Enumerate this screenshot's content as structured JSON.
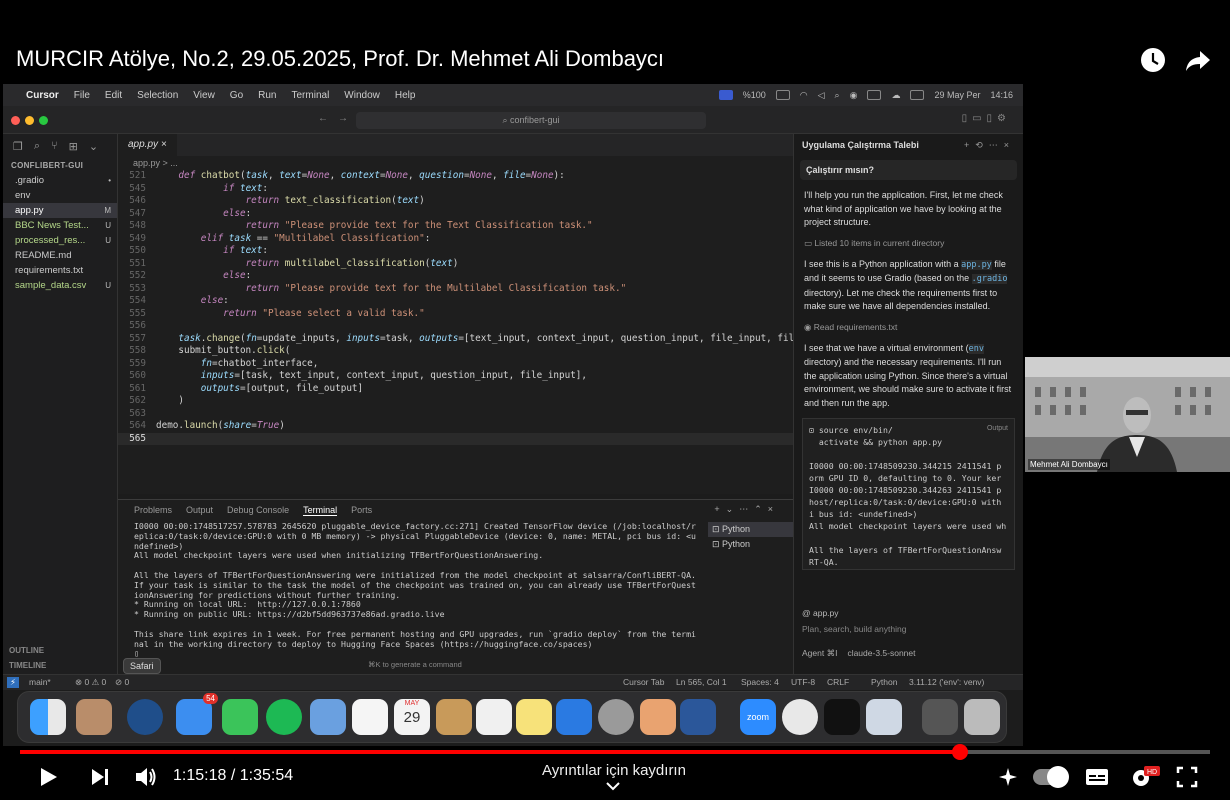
{
  "video": {
    "title": "MURCIR Atölye, No.2, 29.05.2025, Prof. Dr. Mehmet Ali Dombaycı",
    "current_time": "1:15:18",
    "separator": "/",
    "duration": "1:35:54",
    "progress_fraction": 0.79,
    "scroll_hint": "Ayrıntılar için kaydırın"
  },
  "mac_menu": {
    "app": "Cursor",
    "items": [
      "File",
      "Edit",
      "Selection",
      "View",
      "Go",
      "Run",
      "Terminal",
      "Window",
      "Help"
    ],
    "battery": "%100",
    "date": "29 May Per",
    "time": "14:16"
  },
  "window": {
    "search": "confibert-gui"
  },
  "explorer": {
    "project": "CONFLIBERT-GUI",
    "files": [
      {
        "name": ".gradio",
        "status": "•"
      },
      {
        "name": "env",
        "status": ""
      },
      {
        "name": "app.py",
        "status": "M"
      },
      {
        "name": "BBC News Test...",
        "status": "U"
      },
      {
        "name": "processed_res...",
        "status": "U"
      },
      {
        "name": "README.md",
        "status": ""
      },
      {
        "name": "requirements.txt",
        "status": ""
      },
      {
        "name": "sample_data.csv",
        "status": "U"
      }
    ],
    "outline": "OUTLINE",
    "timeline": "TIMELINE"
  },
  "editor": {
    "tab": "app.py",
    "breadcrumb": "app.py > ...",
    "line_numbers": [
      "521",
      "545",
      "546",
      "547",
      "548",
      "549",
      "550",
      "551",
      "552",
      "553",
      "554",
      "555",
      "556",
      "557",
      "558",
      "559",
      "560",
      "561",
      "562",
      "563",
      "564",
      "565"
    ]
  },
  "panel": {
    "tabs": [
      "Problems",
      "Output",
      "Debug Console",
      "Terminal",
      "Ports"
    ],
    "terminal_output": "I0000 00:00:1748517257.578783 2645620 pluggable_device_factory.cc:271] Created TensorFlow device (/job:localhost/replica:0/task:0/device:GPU:0 with 0 MB memory) -> physical PluggableDevice (device: 0, name: METAL, pci bus id: <undefined>)\nAll model checkpoint layers were used when initializing TFBertForQuestionAnswering.\n\nAll the layers of TFBertForQuestionAnswering were initialized from the model checkpoint at salsarra/ConfliBERT-QA.\nIf your task is similar to the task the model of the checkpoint was trained on, you can already use TFBertForQuestionAnswering for predictions without further training.\n* Running on local URL:  http://127.0.0.1:7860\n* Running on public URL: https://d2bf5dd963737e86ad.gradio.live\n\nThis share link expires in 1 week. For free permanent hosting and GPU upgrades, run `gradio deploy` from the terminal in the working directory to deploy to Hugging Face Spaces (https://huggingface.co/spaces)\n▯",
    "terminals": [
      "Python",
      "Python"
    ],
    "hint": "⌘K to generate a command"
  },
  "chat": {
    "header": "Uygulama Çalıştırma Talebi",
    "question": "Çalıştırır mısın?",
    "p1": "I'll help you run the application. First, let me check what kind of application we have by looking at the project structure.",
    "meta1": "Listed 10 items in current directory",
    "p2a": "I see this is a Python application with a ",
    "p2code1": "app.py",
    "p2b": " file and it seems to use Gradio (based on the ",
    "p2code2": ".gradio",
    "p2c": " directory). Let me check the requirements first to make sure we have all dependencies installed.",
    "meta2": "Read requirements.txt",
    "p3a": "I see that we have a virtual environment (",
    "p3code": "env",
    "p3b": " directory) and the necessary requirements. I'll run the application using Python. Since there's a virtual environment, we should make sure to activate it first and then run the app.",
    "code_badge": "Output",
    "code_block": "⊡ source env/bin/\n  activate && python app.py\n\nI0000 00:00:1748509230.344215 2411541 p\norm GPU ID 0, defaulting to 0. Your ker\nI0000 00:00:1748509230.344263 2411541 p\nhost/replica:0/task:0/device:GPU:0 with\ni bus id: <undefined>)\nAll model checkpoint layers were used wh\n\nAll the layers of TFBertForQuestionAnsw\nRT-QA.\nIf your task is similar to the task the",
    "context_file": "app.py",
    "placeholder": "Plan, search, build anything",
    "agent": "Agent ⌘I",
    "model": "claude-3.5-sonnet"
  },
  "statusbar": {
    "branch": "main*",
    "problems": "⊗ 0 ⚠ 0",
    "ports": "⊘ 0",
    "cursor_tab": "Cursor Tab",
    "position": "Ln 565, Col 1",
    "spaces": "Spaces: 4",
    "encoding": "UTF-8",
    "eol": "CRLF",
    "language": "Python",
    "env": "3.11.12 ('env': venv)"
  },
  "dock": {
    "tooltip": "Safari",
    "mail_badge": "54",
    "calendar_month": "MAY",
    "calendar_day": "29",
    "zoom_label": "zoom"
  },
  "webcam": {
    "name": "Mehmet Ali Dombaycı"
  },
  "colors": {
    "progress": "#ff0000",
    "accent": "#6cb3e0"
  }
}
